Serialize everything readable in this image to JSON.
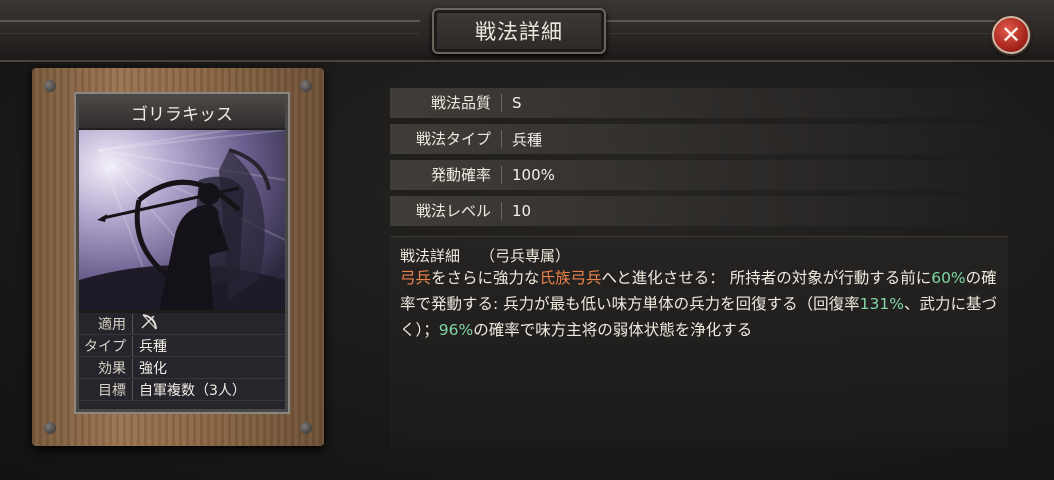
{
  "header": {
    "title": "戦法詳細"
  },
  "card": {
    "name": "ゴリラキッス",
    "info": [
      {
        "key": "適用",
        "value": "",
        "icon": "bow-icon"
      },
      {
        "key": "タイプ",
        "value": "兵種"
      },
      {
        "key": "効果",
        "value": "強化"
      },
      {
        "key": "目標",
        "value": "自軍複数（3人）"
      }
    ]
  },
  "stats": [
    {
      "label": "戦法品質",
      "value": "S"
    },
    {
      "label": "戦法タイプ",
      "value": "兵種"
    },
    {
      "label": "発動確率",
      "value": "100%"
    },
    {
      "label": "戦法レベル",
      "value": "10"
    }
  ],
  "detail": {
    "label": "戦法詳細",
    "tag": "（弓兵専属）",
    "segments": [
      {
        "text": "弓兵",
        "style": "orange"
      },
      {
        "text": "をさらに強力な",
        "style": "plain"
      },
      {
        "text": "氏族弓兵",
        "style": "orange"
      },
      {
        "text": "へと進化させる： 所持者の対象が行動する前に",
        "style": "plain"
      },
      {
        "text": "60%",
        "style": "green"
      },
      {
        "text": "の確率で発動する: 兵力が最も低い味方単体の兵力を回復する（回復率",
        "style": "plain"
      },
      {
        "text": "131%",
        "style": "green"
      },
      {
        "text": "、武力に基づく）；",
        "style": "plain"
      },
      {
        "text": "96%",
        "style": "green"
      },
      {
        "text": "の確率で味方主将の弱体状態を浄化する",
        "style": "plain"
      }
    ]
  },
  "colors": {
    "highlight_orange": "#e9824a",
    "highlight_green": "#7fd6a2",
    "close_red": "#a4231a"
  }
}
